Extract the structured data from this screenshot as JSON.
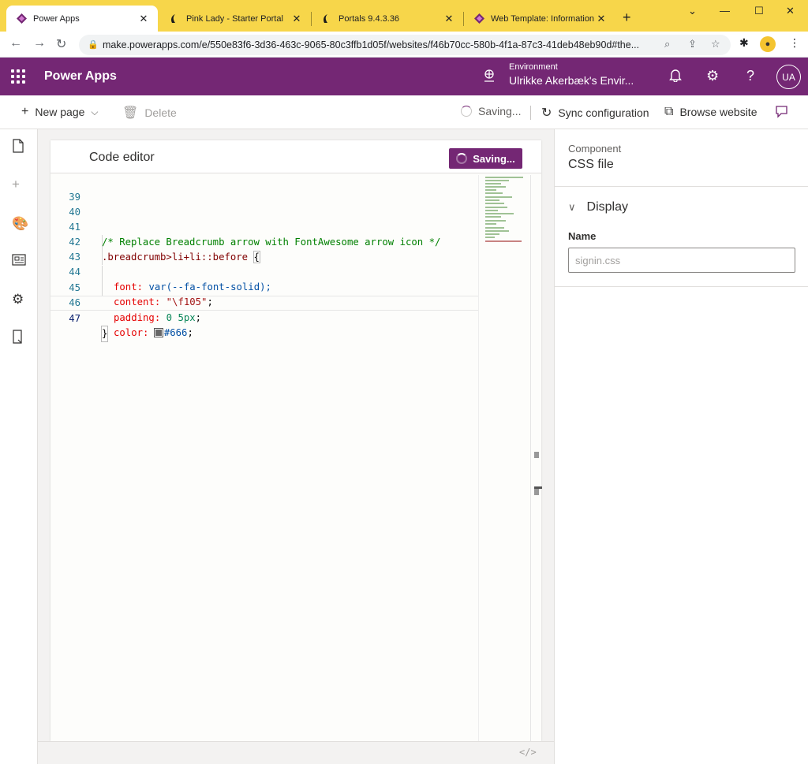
{
  "browser": {
    "tabs": [
      {
        "title": "Power Apps",
        "icon": "powerapps-icon",
        "active": true
      },
      {
        "title": "Pink Lady - Starter Portal",
        "icon": "portal-icon",
        "active": false
      },
      {
        "title": "Portals 9.4.3.36",
        "icon": "portal-icon",
        "active": false
      },
      {
        "title": "Web Template: Information",
        "icon": "powerapps-icon",
        "active": false
      }
    ],
    "url": "make.powerapps.com/e/550e83f6-3d36-463c-9065-80c3ffb1d05f/websites/f46b70cc-580b-4f1a-87c3-41deb48eb90d#the..."
  },
  "app": {
    "name": "Power Apps",
    "environment_label": "Environment",
    "environment_name": "Ulrikke Akerbæk's Envir...",
    "avatar": "UA",
    "brand_color": "#742774"
  },
  "commandbar": {
    "new_page": "New page",
    "delete": "Delete",
    "saving": "Saving...",
    "sync": "Sync configuration",
    "browse": "Browse website"
  },
  "editor": {
    "title": "Code editor",
    "save_button": "Saving...",
    "lines": [
      {
        "num": "39",
        "text": ""
      },
      {
        "num": "40",
        "text": ""
      },
      {
        "num": "41",
        "text": "/* Replace Breadcrumb arrow with FontAwesome arrow icon */"
      },
      {
        "num": "42",
        "text": ".breadcrumb>li+li::before {"
      },
      {
        "num": "43",
        "text": "  font: var(--fa-font-solid);"
      },
      {
        "num": "44",
        "text": "  content: \"\\f105\";"
      },
      {
        "num": "45",
        "text": "  padding: 0 5px;"
      },
      {
        "num": "46",
        "text": "  color: #666;"
      },
      {
        "num": "47",
        "text": "}"
      }
    ],
    "tokens": {
      "comment": "/* Replace Breadcrumb arrow with FontAwesome arrow icon */",
      "selector": ".breadcrumb>li+li::before",
      "open_brace": "{",
      "font_prop": "font:",
      "font_val": "var(--fa-font-solid);",
      "content_prop": "content:",
      "content_val": "\"\\f105\"",
      "padding_prop": "padding:",
      "padding_val": "0 5px",
      "color_prop": "color:",
      "color_val": "#666",
      "semicolon": ";",
      "close_brace": "}"
    },
    "footer_icon": "</>"
  },
  "properties": {
    "component_label": "Component",
    "component_type": "CSS file",
    "section": "Display",
    "name_label": "Name",
    "name_placeholder": "signin.css"
  }
}
